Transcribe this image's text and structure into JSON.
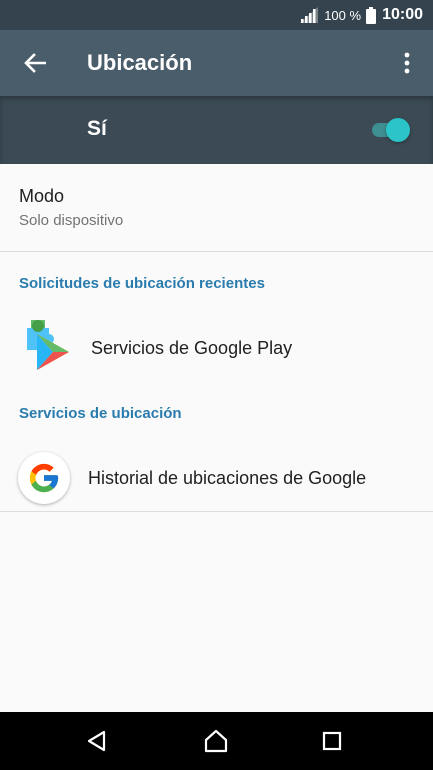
{
  "status_bar": {
    "battery_percent": "100 %",
    "time": "10:00"
  },
  "app_bar": {
    "title": "Ubicación",
    "back_icon": "arrow-back-icon",
    "more_icon": "more-vert-icon"
  },
  "master_switch": {
    "label": "Sí",
    "state": "on",
    "accent_color": "#2bc4c9"
  },
  "mode": {
    "title": "Modo",
    "value": "Solo dispositivo"
  },
  "recent_requests": {
    "header": "Solicitudes de ubicación recientes",
    "items": [
      {
        "label": "Servicios de Google Play",
        "icon": "google-play-services-icon"
      }
    ]
  },
  "location_services": {
    "header": "Servicios de ubicación",
    "items": [
      {
        "label": "Historial de ubicaciones de Google",
        "icon": "google-icon"
      }
    ]
  },
  "colors": {
    "status_bar": "#34434d",
    "app_bar": "#4a5d6a",
    "switch_bar": "#3b4a54",
    "section_header": "#2a7cae"
  },
  "nav_bar": {
    "back_icon": "nav-back-icon",
    "home_icon": "nav-home-icon",
    "recents_icon": "nav-recents-icon"
  }
}
